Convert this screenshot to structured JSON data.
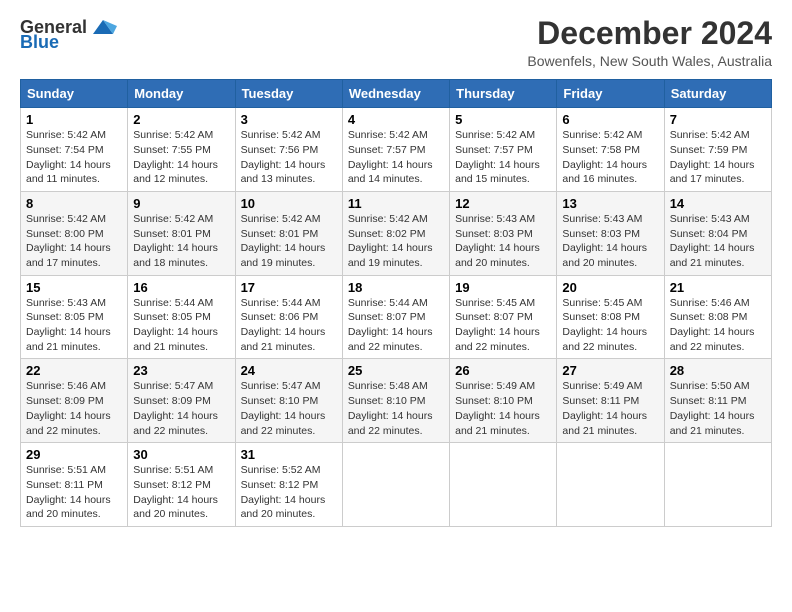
{
  "logo": {
    "general": "General",
    "blue": "Blue"
  },
  "title": "December 2024",
  "subtitle": "Bowenfels, New South Wales, Australia",
  "days_header": [
    "Sunday",
    "Monday",
    "Tuesday",
    "Wednesday",
    "Thursday",
    "Friday",
    "Saturday"
  ],
  "weeks": [
    [
      {
        "day": "1",
        "sunrise": "5:42 AM",
        "sunset": "7:54 PM",
        "daylight": "14 hours and 11 minutes."
      },
      {
        "day": "2",
        "sunrise": "5:42 AM",
        "sunset": "7:55 PM",
        "daylight": "14 hours and 12 minutes."
      },
      {
        "day": "3",
        "sunrise": "5:42 AM",
        "sunset": "7:56 PM",
        "daylight": "14 hours and 13 minutes."
      },
      {
        "day": "4",
        "sunrise": "5:42 AM",
        "sunset": "7:57 PM",
        "daylight": "14 hours and 14 minutes."
      },
      {
        "day": "5",
        "sunrise": "5:42 AM",
        "sunset": "7:57 PM",
        "daylight": "14 hours and 15 minutes."
      },
      {
        "day": "6",
        "sunrise": "5:42 AM",
        "sunset": "7:58 PM",
        "daylight": "14 hours and 16 minutes."
      },
      {
        "day": "7",
        "sunrise": "5:42 AM",
        "sunset": "7:59 PM",
        "daylight": "14 hours and 17 minutes."
      }
    ],
    [
      {
        "day": "8",
        "sunrise": "5:42 AM",
        "sunset": "8:00 PM",
        "daylight": "14 hours and 17 minutes."
      },
      {
        "day": "9",
        "sunrise": "5:42 AM",
        "sunset": "8:01 PM",
        "daylight": "14 hours and 18 minutes."
      },
      {
        "day": "10",
        "sunrise": "5:42 AM",
        "sunset": "8:01 PM",
        "daylight": "14 hours and 19 minutes."
      },
      {
        "day": "11",
        "sunrise": "5:42 AM",
        "sunset": "8:02 PM",
        "daylight": "14 hours and 19 minutes."
      },
      {
        "day": "12",
        "sunrise": "5:43 AM",
        "sunset": "8:03 PM",
        "daylight": "14 hours and 20 minutes."
      },
      {
        "day": "13",
        "sunrise": "5:43 AM",
        "sunset": "8:03 PM",
        "daylight": "14 hours and 20 minutes."
      },
      {
        "day": "14",
        "sunrise": "5:43 AM",
        "sunset": "8:04 PM",
        "daylight": "14 hours and 21 minutes."
      }
    ],
    [
      {
        "day": "15",
        "sunrise": "5:43 AM",
        "sunset": "8:05 PM",
        "daylight": "14 hours and 21 minutes."
      },
      {
        "day": "16",
        "sunrise": "5:44 AM",
        "sunset": "8:05 PM",
        "daylight": "14 hours and 21 minutes."
      },
      {
        "day": "17",
        "sunrise": "5:44 AM",
        "sunset": "8:06 PM",
        "daylight": "14 hours and 21 minutes."
      },
      {
        "day": "18",
        "sunrise": "5:44 AM",
        "sunset": "8:07 PM",
        "daylight": "14 hours and 22 minutes."
      },
      {
        "day": "19",
        "sunrise": "5:45 AM",
        "sunset": "8:07 PM",
        "daylight": "14 hours and 22 minutes."
      },
      {
        "day": "20",
        "sunrise": "5:45 AM",
        "sunset": "8:08 PM",
        "daylight": "14 hours and 22 minutes."
      },
      {
        "day": "21",
        "sunrise": "5:46 AM",
        "sunset": "8:08 PM",
        "daylight": "14 hours and 22 minutes."
      }
    ],
    [
      {
        "day": "22",
        "sunrise": "5:46 AM",
        "sunset": "8:09 PM",
        "daylight": "14 hours and 22 minutes."
      },
      {
        "day": "23",
        "sunrise": "5:47 AM",
        "sunset": "8:09 PM",
        "daylight": "14 hours and 22 minutes."
      },
      {
        "day": "24",
        "sunrise": "5:47 AM",
        "sunset": "8:10 PM",
        "daylight": "14 hours and 22 minutes."
      },
      {
        "day": "25",
        "sunrise": "5:48 AM",
        "sunset": "8:10 PM",
        "daylight": "14 hours and 22 minutes."
      },
      {
        "day": "26",
        "sunrise": "5:49 AM",
        "sunset": "8:10 PM",
        "daylight": "14 hours and 21 minutes."
      },
      {
        "day": "27",
        "sunrise": "5:49 AM",
        "sunset": "8:11 PM",
        "daylight": "14 hours and 21 minutes."
      },
      {
        "day": "28",
        "sunrise": "5:50 AM",
        "sunset": "8:11 PM",
        "daylight": "14 hours and 21 minutes."
      }
    ],
    [
      {
        "day": "29",
        "sunrise": "5:51 AM",
        "sunset": "8:11 PM",
        "daylight": "14 hours and 20 minutes."
      },
      {
        "day": "30",
        "sunrise": "5:51 AM",
        "sunset": "8:12 PM",
        "daylight": "14 hours and 20 minutes."
      },
      {
        "day": "31",
        "sunrise": "5:52 AM",
        "sunset": "8:12 PM",
        "daylight": "14 hours and 20 minutes."
      },
      null,
      null,
      null,
      null
    ]
  ],
  "labels": {
    "sunrise": "Sunrise:",
    "sunset": "Sunset:",
    "daylight": "Daylight hours"
  }
}
